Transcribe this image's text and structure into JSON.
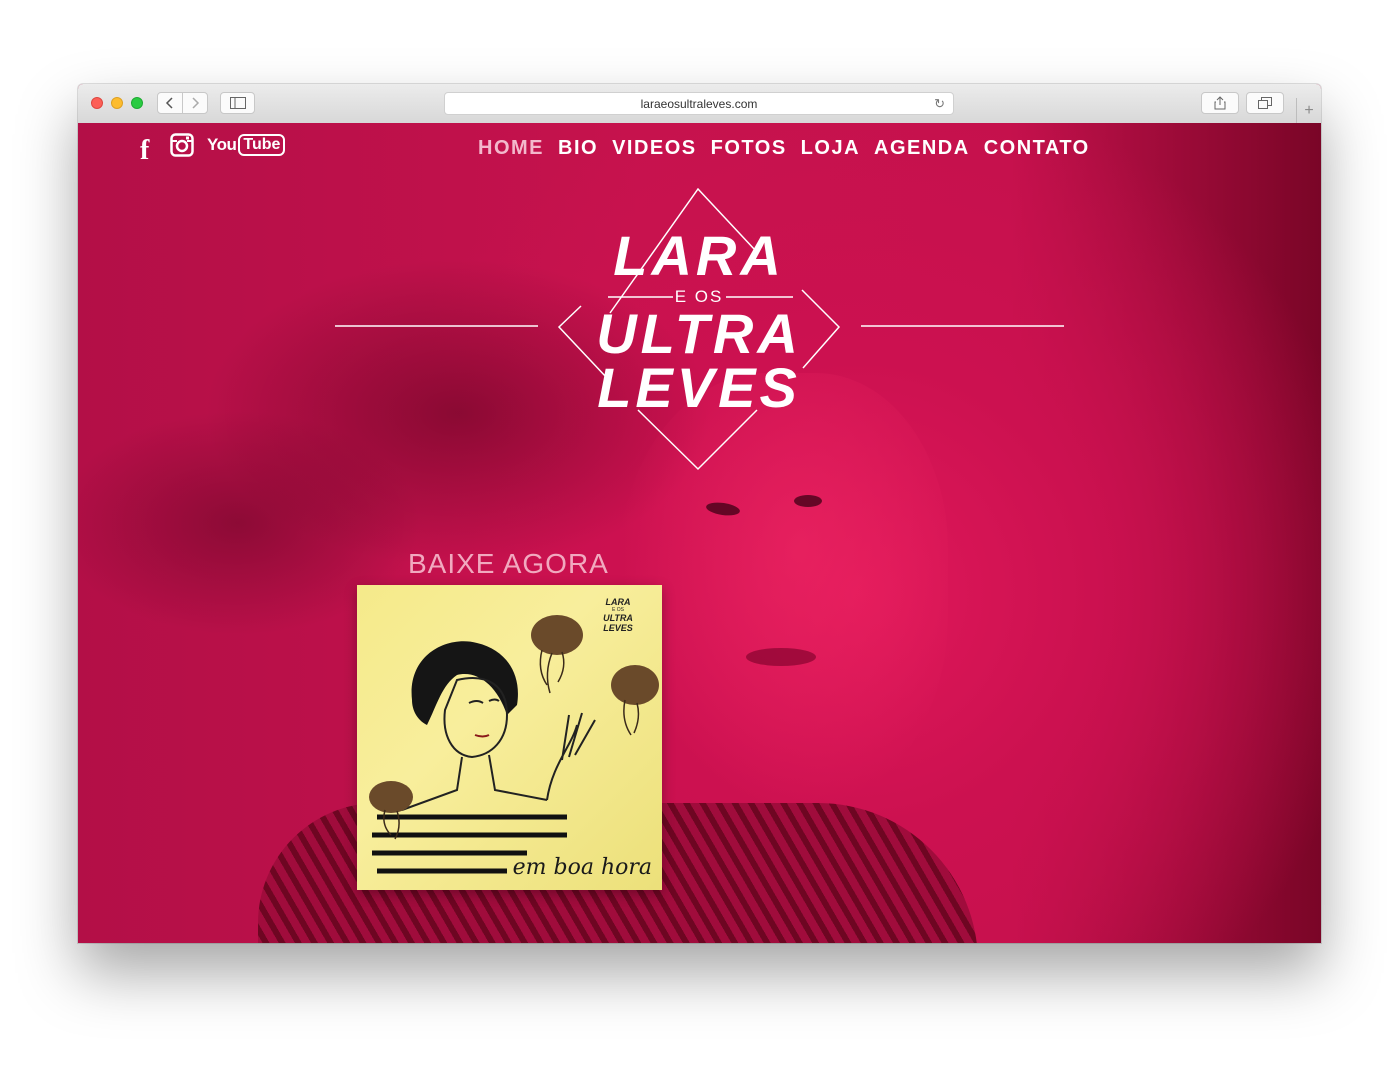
{
  "browser": {
    "url": "laraeosultraleves.com"
  },
  "social": {
    "facebook": "f",
    "youtube_you": "You",
    "youtube_tube": "Tube"
  },
  "nav": {
    "items": [
      {
        "label": "HOME"
      },
      {
        "label": "BIO"
      },
      {
        "label": "VIDEOS"
      },
      {
        "label": "FOTOS"
      },
      {
        "label": "LOJA"
      },
      {
        "label": "AGENDA"
      },
      {
        "label": "CONTATO"
      }
    ]
  },
  "logo": {
    "line1": "LARA",
    "middle": "E OS",
    "line2": "ULTRA",
    "line3": "LEVES"
  },
  "cta": {
    "title": "BAIXE AGORA"
  },
  "album": {
    "caption": "em boa hora",
    "logo_line1": "LARA",
    "logo_middle": "E OS",
    "logo_line2": "ULTRA",
    "logo_line3": "LEVES"
  },
  "colors": {
    "background": "#c2104a",
    "nav_active": "#f3b8cc",
    "cta": "#f1a9bf",
    "album": "#f5ea8a"
  },
  "icons": [
    "facebook-icon",
    "instagram-icon",
    "youtube-icon",
    "back-icon",
    "forward-icon",
    "sidebar-icon",
    "reload-icon",
    "share-icon",
    "tabs-icon",
    "new-tab-icon"
  ]
}
